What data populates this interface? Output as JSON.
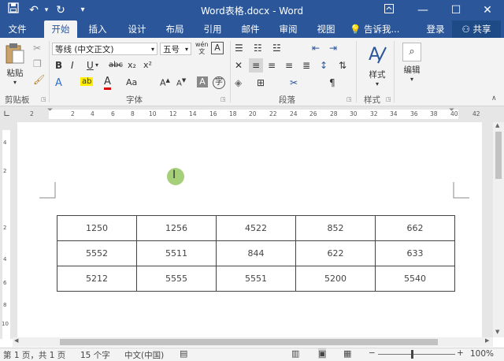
{
  "titlebar": {
    "title": "Word表格.docx - Word"
  },
  "tabs": [
    {
      "label": "文件",
      "active": false
    },
    {
      "label": "开始",
      "active": true
    },
    {
      "label": "插入",
      "active": false
    },
    {
      "label": "设计",
      "active": false
    },
    {
      "label": "布局",
      "active": false
    },
    {
      "label": "引用",
      "active": false
    },
    {
      "label": "邮件",
      "active": false
    },
    {
      "label": "审阅",
      "active": false
    },
    {
      "label": "视图",
      "active": false
    }
  ],
  "tell_me": "告诉我...",
  "signin": "登录",
  "share": "共享",
  "ribbon": {
    "clipboard": {
      "paste": "粘贴",
      "group": "剪贴板"
    },
    "font": {
      "name": "等线 (中文正文)",
      "size": "五号",
      "group": "字体",
      "bold": "B",
      "italic": "I",
      "underline": "U",
      "strike": "abc",
      "sub": "x₂",
      "sup": "x²"
    },
    "paragraph": {
      "group": "段落"
    },
    "styles": {
      "label": "样式",
      "group": "样式"
    },
    "editing": {
      "label": "编辑"
    }
  },
  "ruler": {
    "numbers": [
      "2",
      "2",
      "4",
      "6",
      "8",
      "10",
      "12",
      "14",
      "16",
      "18",
      "20",
      "22",
      "24",
      "26",
      "28",
      "30",
      "32",
      "34",
      "36",
      "38",
      "40",
      "42"
    ]
  },
  "vruler": {
    "numbers": [
      "4",
      "2",
      "2",
      "4",
      "6",
      "8",
      "10"
    ]
  },
  "table": {
    "rows": [
      [
        "1250",
        "1256",
        "4522",
        "852",
        "662"
      ],
      [
        "5552",
        "5511",
        "844",
        "622",
        "633"
      ],
      [
        "5212",
        "5555",
        "5551",
        "5200",
        "5540"
      ]
    ]
  },
  "status": {
    "page": "第 1 页，共 1 页",
    "words": "15 个字",
    "lang": "中文(中国)",
    "zoom": "100%"
  }
}
